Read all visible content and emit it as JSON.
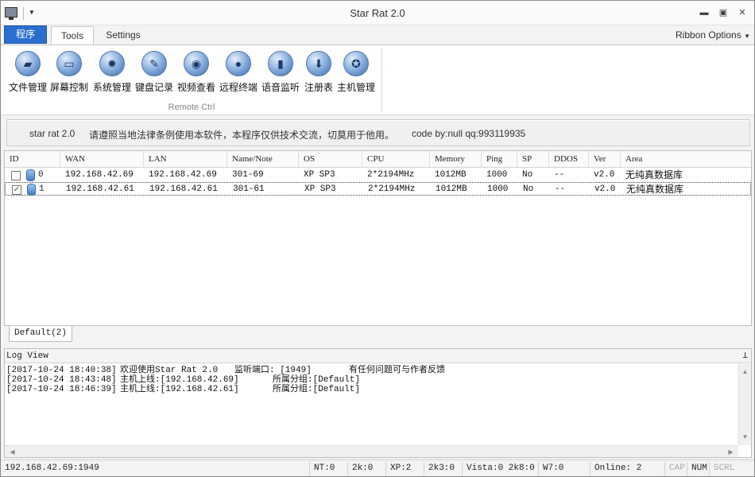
{
  "window": {
    "title": "Star Rat 2.0"
  },
  "tabs": {
    "app": "程序",
    "tools": "Tools",
    "settings": "Settings",
    "ribbon_options": "Ribbon Options"
  },
  "ribbon": {
    "buttons": [
      {
        "label": "文件管理",
        "icon": "folder-icon"
      },
      {
        "label": "屏幕控制",
        "icon": "monitor-icon"
      },
      {
        "label": "系统管理",
        "icon": "gear-icon"
      },
      {
        "label": "键盘记录",
        "icon": "pencil-icon"
      },
      {
        "label": "视频查看",
        "icon": "camera-icon"
      },
      {
        "label": "远程终端",
        "icon": "chat-icon"
      },
      {
        "label": "语音监听",
        "icon": "equalizer-icon"
      },
      {
        "label": "注册表",
        "icon": "download-arrow-icon"
      },
      {
        "label": "主机管理",
        "icon": "badge-icon"
      }
    ],
    "group_label": "Remote Ctrl"
  },
  "banner": {
    "name": "star rat 2.0",
    "notice": "请遵照当地法律条例使用本软件，本程序仅供技术交流，切莫用于他用。",
    "code": "code by:null qq:993119935"
  },
  "table": {
    "columns": [
      "ID",
      "WAN",
      "LAN",
      "Name/Note",
      "OS",
      "CPU",
      "Memory",
      "Ping",
      "SP",
      "DDOS",
      "Ver",
      "Area"
    ],
    "rows": [
      {
        "checked": false,
        "id": "0",
        "wan": "192.168.42.69",
        "lan": "192.168.42.69",
        "name": "301-69",
        "os": "XP SP3",
        "cpu": "2*2194MHz",
        "memory": "1012MB",
        "ping": "1000",
        "sp": "No",
        "ddos": "--",
        "ver": "v2.0",
        "area": "无纯真数据库"
      },
      {
        "checked": true,
        "id": "1",
        "wan": "192.168.42.61",
        "lan": "192.168.42.61",
        "name": "301-61",
        "os": "XP SP3",
        "cpu": "2*2194MHz",
        "memory": "1012MB",
        "ping": "1000",
        "sp": "No",
        "ddos": "--",
        "ver": "v2.0",
        "area": "无纯真数据库"
      }
    ]
  },
  "group_tab": "Default(2)",
  "log": {
    "title": "Log View",
    "lines": [
      {
        "time": "[2017-10-24 18:40:38]",
        "msg1": "欢迎使用Star Rat 2.0",
        "msg2": "监听端口: [1949]",
        "msg3": "有任何问题可与作者反馈"
      },
      {
        "time": "[2017-10-24 18:43:48]",
        "msg1": "主机上线:[192.168.42.69]",
        "msg2": "所属分组:[Default]",
        "msg3": ""
      },
      {
        "time": "[2017-10-24 18:46:39]",
        "msg1": "主机上线:[192.168.42.61]",
        "msg2": "所属分组:[Default]",
        "msg3": ""
      }
    ]
  },
  "status": {
    "address": "192.168.42.69:1949",
    "nt": "NT:0",
    "k2": "2k:0",
    "xp": "XP:2",
    "k3": "2k3:0",
    "vista": "Vista:0 2k8:0",
    "w7": "W7:0",
    "online": "Online: 2",
    "cap": "CAP",
    "num": "NUM",
    "scrl": "SCRL"
  }
}
